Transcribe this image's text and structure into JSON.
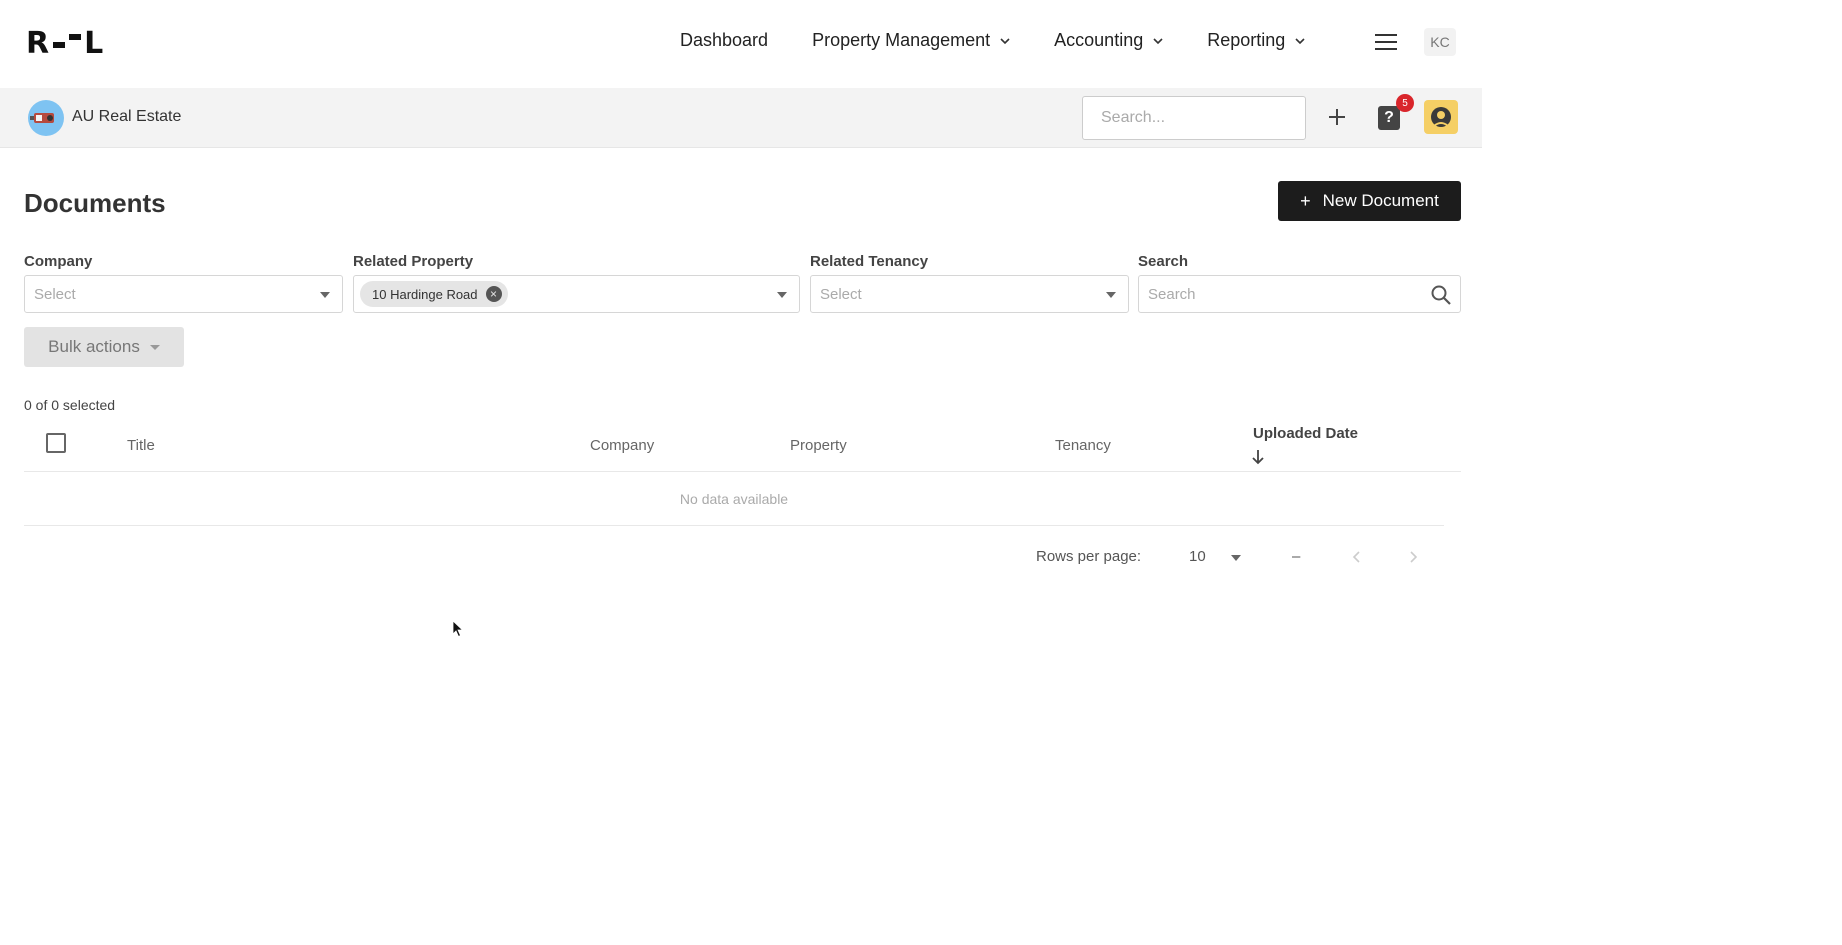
{
  "nav": {
    "logo": "R--L",
    "links": [
      {
        "label": "Dashboard",
        "has_dropdown": false
      },
      {
        "label": "Property Management",
        "has_dropdown": true
      },
      {
        "label": "Accounting",
        "has_dropdown": true
      },
      {
        "label": "Reporting",
        "has_dropdown": true
      }
    ],
    "user_initials": "KC"
  },
  "orgbar": {
    "org_name": "AU Real Estate",
    "search_placeholder": "Search...",
    "notification_count": "5",
    "help_icon": "question-icon"
  },
  "page": {
    "title": "Documents",
    "new_button": "New Document"
  },
  "filters": {
    "company": {
      "label": "Company",
      "placeholder": "Select"
    },
    "property": {
      "label": "Related Property",
      "chip": "10 Hardinge Road"
    },
    "tenancy": {
      "label": "Related Tenancy",
      "placeholder": "Select"
    },
    "search": {
      "label": "Search",
      "placeholder": "Search"
    }
  },
  "bulk_actions": "Bulk actions",
  "selection": "0 of 0 selected",
  "table": {
    "columns": [
      "Title",
      "Company",
      "Property",
      "Tenancy",
      "Uploaded Date"
    ],
    "empty_text": "No data available"
  },
  "pagination": {
    "rows_per_page_label": "Rows per page:",
    "rows_per_page": "10",
    "range": "–"
  },
  "colors": {
    "primary_button": "#1c1c1c",
    "badge": "#d9252b",
    "org_avatar": "#7ec3f2",
    "profile_avatar": "#f5cf65"
  }
}
